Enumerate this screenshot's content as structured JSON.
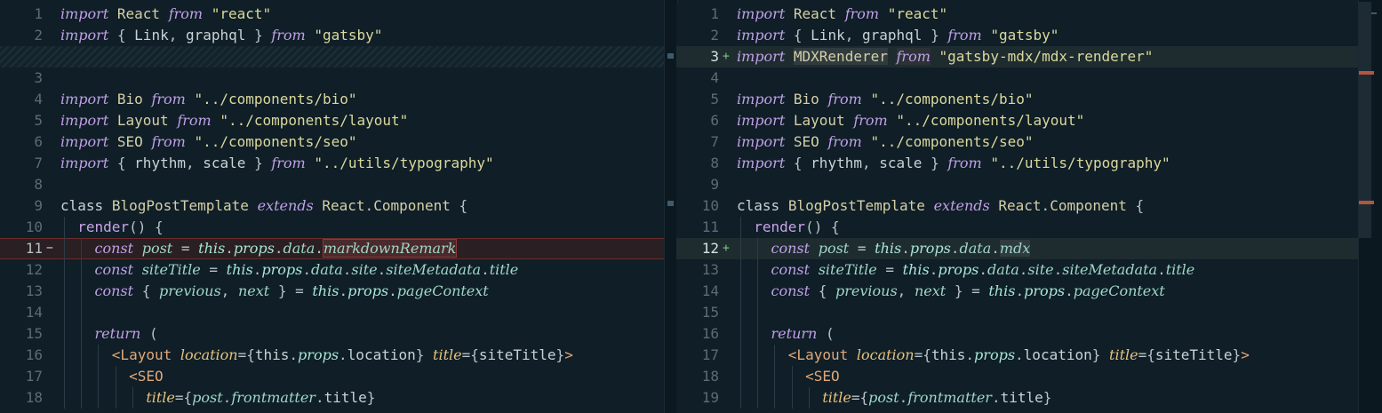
{
  "left": {
    "rows": [
      {
        "num": "1",
        "code": "<span class=\"kw\">import</span> <span class=\"cls\">React</span> <span class=\"kw\">from</span> <span class=\"str\">\"react\"</span>"
      },
      {
        "num": "2",
        "code": "<span class=\"kw\">import</span> <span class=\"op\">{</span> <span class=\"id\">Link</span><span class=\"op\">,</span> <span class=\"id\">graphql</span> <span class=\"op\">}</span> <span class=\"kw\">from</span> <span class=\"str\">\"gatsby\"</span>"
      },
      {
        "filler": true,
        "num": "",
        "code": ""
      },
      {
        "num": "3",
        "code": ""
      },
      {
        "num": "4",
        "code": "<span class=\"kw\">import</span> <span class=\"cls\">Bio</span> <span class=\"kw\">from</span> <span class=\"str\">\"../components/bio\"</span>"
      },
      {
        "num": "5",
        "code": "<span class=\"kw\">import</span> <span class=\"cls\">Layout</span> <span class=\"kw\">from</span> <span class=\"str\">\"../components/layout\"</span>"
      },
      {
        "num": "6",
        "code": "<span class=\"kw\">import</span> <span class=\"cls\">SEO</span> <span class=\"kw\">from</span> <span class=\"str\">\"../components/seo\"</span>"
      },
      {
        "num": "7",
        "code": "<span class=\"kw\">import</span> <span class=\"op\">{</span> <span class=\"id\">rhythm</span><span class=\"op\">,</span> <span class=\"id\">scale</span> <span class=\"op\">}</span> <span class=\"kw\">from</span> <span class=\"str\">\"../utils/typography\"</span>"
      },
      {
        "num": "8",
        "code": ""
      },
      {
        "num": "9",
        "code": "<span class=\"id\">class</span> <span class=\"cls\">BlogPostTemplate</span> <span class=\"kw\">extends</span> <span class=\"cls\">React</span><span class=\"op\">.</span><span class=\"cls\">Component</span> <span class=\"op\">{</span>"
      },
      {
        "num": "10",
        "guides": [
          1
        ],
        "code": "  <span class=\"fn\">render</span><span class=\"op\">() {</span>"
      },
      {
        "num": "11",
        "removed": true,
        "mark": "−",
        "guides": [
          1,
          2
        ],
        "code": "    <span class=\"vr\">const</span> <span class=\"pr\">post</span> <span class=\"op\">=</span> <span class=\"this\">this</span><span class=\"op\">.</span><span class=\"this\">props</span><span class=\"op\">.</span><span class=\"pr\">data</span><span class=\"op\">.</span><span class=\"pr hl-old\">markdownRemark</span>"
      },
      {
        "num": "12",
        "guides": [
          1,
          2
        ],
        "code": "    <span class=\"vr\">const</span> <span class=\"pr\">siteTitle</span> <span class=\"op\">=</span> <span class=\"this\">this</span><span class=\"op\">.</span><span class=\"this\">props</span><span class=\"op\">.</span><span class=\"pr\">data</span><span class=\"op\">.</span><span class=\"pr\">site</span><span class=\"op\">.</span><span class=\"pr\">siteMetadata</span><span class=\"op\">.</span><span class=\"pr\">title</span>"
      },
      {
        "num": "13",
        "guides": [
          1,
          2
        ],
        "code": "    <span class=\"vr\">const</span> <span class=\"op\">{</span> <span class=\"pr\">previous</span><span class=\"op\">,</span> <span class=\"pr\">next</span> <span class=\"op\">} =</span> <span class=\"this\">this</span><span class=\"op\">.</span><span class=\"this\">props</span><span class=\"op\">.</span><span class=\"pr\">pageContext</span>"
      },
      {
        "num": "14",
        "guides": [
          1,
          2
        ],
        "code": ""
      },
      {
        "num": "15",
        "guides": [
          1,
          2
        ],
        "code": "    <span class=\"kw\">return</span> <span class=\"op\">(</span>"
      },
      {
        "num": "16",
        "guides": [
          1,
          2,
          3
        ],
        "code": "      <span class=\"tag\">&lt;Layout</span> <span class=\"attr\">location</span><span class=\"op\">={</span><span class=\"id\">this</span><span class=\"op\">.</span><span class=\"this\">props</span><span class=\"op\">.</span><span class=\"id\">location</span><span class=\"op\">}</span> <span class=\"attr\">title</span><span class=\"op\">={</span><span class=\"id\">siteTitle</span><span class=\"op\">}</span><span class=\"tag\">&gt;</span>"
      },
      {
        "num": "17",
        "guides": [
          1,
          2,
          3,
          4
        ],
        "code": "        <span class=\"tag\">&lt;SEO</span>"
      },
      {
        "num": "18",
        "guides": [
          1,
          2,
          3,
          4,
          5
        ],
        "code": "          <span class=\"attr\">title</span><span class=\"op\">={</span><span class=\"pr\">post</span><span class=\"op\">.</span><span class=\"pr\">frontmatter</span><span class=\"op\">.</span><span class=\"id\">title</span><span class=\"op\">}</span>"
      }
    ]
  },
  "right": {
    "rows": [
      {
        "num": "1",
        "code": "<span class=\"kw\">import</span> <span class=\"cls\">React</span> <span class=\"kw\">from</span> <span class=\"str\">\"react\"</span>"
      },
      {
        "num": "2",
        "code": "<span class=\"kw\">import</span> <span class=\"op\">{</span> <span class=\"id\">Link</span><span class=\"op\">,</span> <span class=\"id\">graphql</span> <span class=\"op\">}</span> <span class=\"kw\">from</span> <span class=\"str\">\"gatsby\"</span>"
      },
      {
        "num": "3",
        "added": true,
        "mark": "+",
        "code": "<span class=\"kw\">import</span> <span class=\"cls hl-new\">MDXRenderer</span> <span class=\"kw hl-kw\">from</span> <span class=\"str\">\"gatsby-mdx/mdx-renderer\"</span>"
      },
      {
        "num": "4",
        "code": ""
      },
      {
        "num": "5",
        "code": "<span class=\"kw\">import</span> <span class=\"cls\">Bio</span> <span class=\"kw\">from</span> <span class=\"str\">\"../components/bio\"</span>"
      },
      {
        "num": "6",
        "code": "<span class=\"kw\">import</span> <span class=\"cls\">Layout</span> <span class=\"kw\">from</span> <span class=\"str\">\"../components/layout\"</span>"
      },
      {
        "num": "7",
        "code": "<span class=\"kw\">import</span> <span class=\"cls\">SEO</span> <span class=\"kw\">from</span> <span class=\"str\">\"../components/seo\"</span>"
      },
      {
        "num": "8",
        "code": "<span class=\"kw\">import</span> <span class=\"op\">{</span> <span class=\"id\">rhythm</span><span class=\"op\">,</span> <span class=\"id\">scale</span> <span class=\"op\">}</span> <span class=\"kw\">from</span> <span class=\"str\">\"../utils/typography\"</span>"
      },
      {
        "num": "9",
        "code": ""
      },
      {
        "num": "10",
        "code": "<span class=\"id\">class</span> <span class=\"cls\">BlogPostTemplate</span> <span class=\"kw\">extends</span> <span class=\"cls\">React</span><span class=\"op\">.</span><span class=\"cls\">Component</span> <span class=\"op\">{</span>"
      },
      {
        "num": "11",
        "guides": [
          1
        ],
        "code": "  <span class=\"fn\">render</span><span class=\"op\">() {</span>"
      },
      {
        "num": "12",
        "added": true,
        "mark": "+",
        "guides": [
          1,
          2
        ],
        "code": "    <span class=\"vr\">const</span> <span class=\"pr\">post</span> <span class=\"op\">=</span> <span class=\"this\">this</span><span class=\"op\">.</span><span class=\"this\">props</span><span class=\"op\">.</span><span class=\"pr\">data</span><span class=\"op\">.</span><span class=\"pr hl-new\">mdx</span>"
      },
      {
        "num": "13",
        "guides": [
          1,
          2
        ],
        "code": "    <span class=\"vr\">const</span> <span class=\"pr\">siteTitle</span> <span class=\"op\">=</span> <span class=\"this\">this</span><span class=\"op\">.</span><span class=\"this\">props</span><span class=\"op\">.</span><span class=\"pr\">data</span><span class=\"op\">.</span><span class=\"pr\">site</span><span class=\"op\">.</span><span class=\"pr\">siteMetadata</span><span class=\"op\">.</span><span class=\"pr\">title</span>"
      },
      {
        "num": "14",
        "guides": [
          1,
          2
        ],
        "code": "    <span class=\"vr\">const</span> <span class=\"op\">{</span> <span class=\"pr\">previous</span><span class=\"op\">,</span> <span class=\"pr\">next</span> <span class=\"op\">} =</span> <span class=\"this\">this</span><span class=\"op\">.</span><span class=\"this\">props</span><span class=\"op\">.</span><span class=\"pr\">pageContext</span>"
      },
      {
        "num": "15",
        "guides": [
          1,
          2
        ],
        "code": ""
      },
      {
        "num": "16",
        "guides": [
          1,
          2
        ],
        "code": "    <span class=\"kw\">return</span> <span class=\"op\">(</span>"
      },
      {
        "num": "17",
        "guides": [
          1,
          2,
          3
        ],
        "code": "      <span class=\"tag\">&lt;Layout</span> <span class=\"attr\">location</span><span class=\"op\">={</span><span class=\"id\">this</span><span class=\"op\">.</span><span class=\"this\">props</span><span class=\"op\">.</span><span class=\"id\">location</span><span class=\"op\">}</span> <span class=\"attr\">title</span><span class=\"op\">={</span><span class=\"id\">siteTitle</span><span class=\"op\">}</span><span class=\"tag\">&gt;</span>"
      },
      {
        "num": "18",
        "guides": [
          1,
          2,
          3,
          4
        ],
        "code": "        <span class=\"tag\">&lt;SEO</span>"
      },
      {
        "num": "19",
        "guides": [
          1,
          2,
          3,
          4,
          5
        ],
        "code": "          <span class=\"attr\">title</span><span class=\"op\">={</span><span class=\"pr\">post</span><span class=\"op\">.</span><span class=\"pr\">frontmatter</span><span class=\"op\">.</span><span class=\"id\">title</span><span class=\"op\">}</span>"
      }
    ]
  },
  "colors": {
    "background": "#0f1e27",
    "removed_line": "#2a1f22",
    "added_line": "#1e2c30",
    "keyword": "#c0a0e6",
    "string": "#dbd89c",
    "property": "#9fd6c6",
    "minimap_change": "#b4553e"
  }
}
